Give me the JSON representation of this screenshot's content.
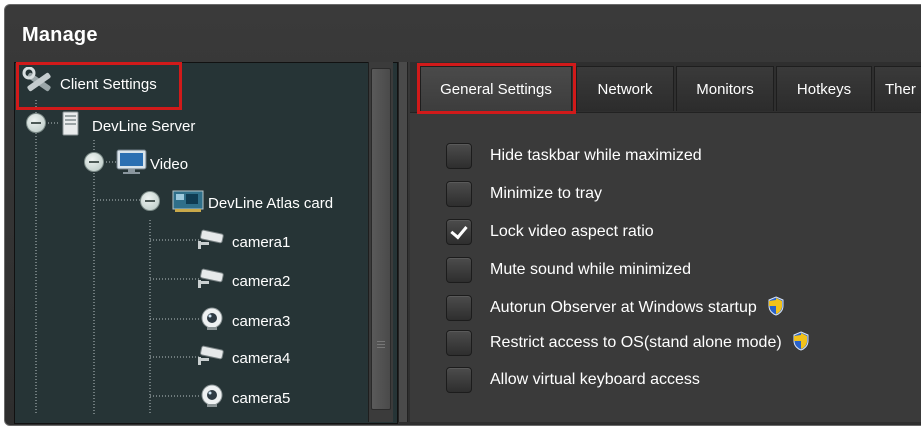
{
  "window": {
    "title": "Manage"
  },
  "tree": {
    "root": "Client Settings",
    "server": "DevLine Server",
    "video": "Video",
    "card": "DevLine Atlas card",
    "cameras": [
      "camera1",
      "camera2",
      "camera3",
      "camera4",
      "camera5"
    ]
  },
  "tabs": [
    "General Settings",
    "Network",
    "Monitors",
    "Hotkeys",
    "Ther"
  ],
  "options": [
    {
      "label": "Hide taskbar while maximized",
      "checked": false
    },
    {
      "label": "Minimize to tray",
      "checked": false
    },
    {
      "label": "Lock video aspect ratio",
      "checked": true
    },
    {
      "label": "Mute sound while minimized",
      "checked": false
    },
    {
      "label": "Autorun Observer at Windows startup",
      "checked": false,
      "icon": "uac-shield-icon"
    },
    {
      "label": "Restrict access to OS(stand alone mode)",
      "checked": false,
      "icon": "uac-shield-icon"
    },
    {
      "label": "Allow virtual keyboard access",
      "checked": false
    }
  ],
  "colors": {
    "highlight": "#d11a1a",
    "tree_bg": "#263436",
    "panel_bg": "#3a3a3a"
  }
}
